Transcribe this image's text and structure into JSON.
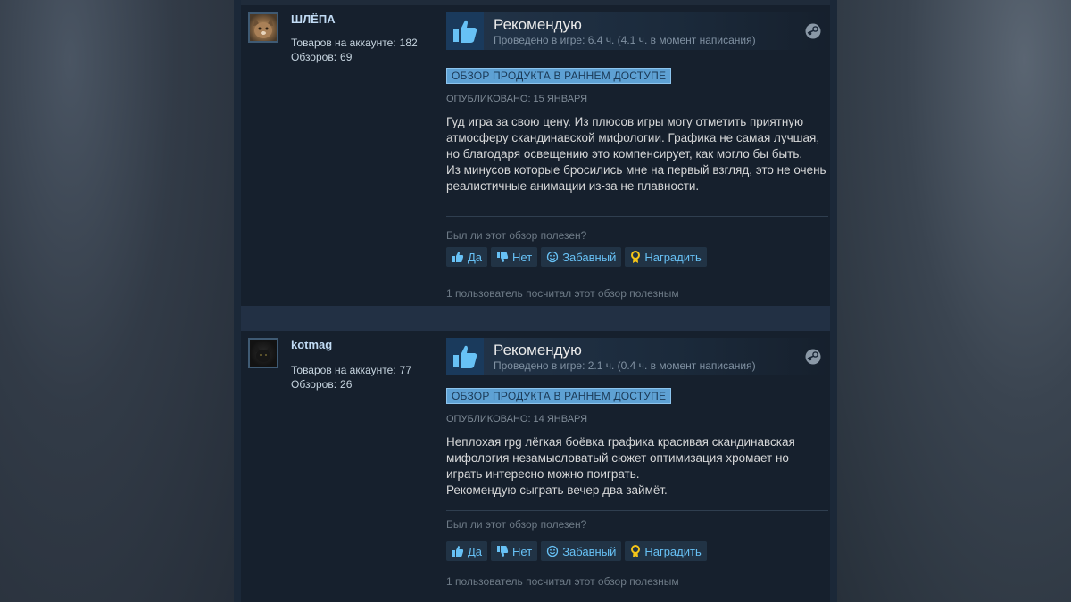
{
  "reviews": [
    {
      "username": "ШЛЁПА",
      "products_label": "Товаров на аккаунте:",
      "products_count": "182",
      "reviews_label": "Обзоров:",
      "reviews_count": "69",
      "verdict": "Рекомендую",
      "playtime": "Проведено в игре: 6.4 ч. (4.1 ч. в момент написания)",
      "early_access": "ОБЗОР ПРОДУКТА В РАННЕМ ДОСТУПЕ",
      "posted": "ОПУБЛИКОВАНО: 15 ЯНВАРЯ",
      "text": "Гуд игра за свою цену. Из плюсов игры могу отметить приятную атмосферу скандинавской мифологии. Графика не самая лучшая, но благодаря освещению это компенсирует, как могло бы быть.\nИз минусов которые бросились мне на первый взгляд, это не очень реалистичные анимации из-за не плавности.",
      "helpful_question": "Был ли этот обзор полезен?",
      "btn_yes": "Да",
      "btn_no": "Нет",
      "btn_funny": "Забавный",
      "btn_award": "Наградить",
      "found_helpful": "1 пользователь посчитал этот обзор полезным"
    },
    {
      "username": "kotmag",
      "products_label": "Товаров на аккаунте:",
      "products_count": "77",
      "reviews_label": "Обзоров:",
      "reviews_count": "26",
      "verdict": "Рекомендую",
      "playtime": "Проведено в игре: 2.1 ч. (0.4 ч. в момент написания)",
      "early_access": "ОБЗОР ПРОДУКТА В РАННЕМ ДОСТУПЕ",
      "posted": "ОПУБЛИКОВАНО: 14 ЯНВАРЯ",
      "text": "Неплохая rpg лёгкая боёвка графика красивая скандинавская мифология незамысловатый сюжет оптимизация хромает но играть интересно можно поиграть.\nРекомендую сыграть вечер два займёт.",
      "helpful_question": "Был ли этот обзор полезен?",
      "btn_yes": "Да",
      "btn_no": "Нет",
      "btn_funny": "Забавный",
      "btn_award": "Наградить",
      "found_helpful": "1 пользователь посчитал этот обзор полезным"
    }
  ],
  "colors": {
    "accent_blue": "#67c1f5",
    "badge_bg": "#5ea1d4",
    "award_gold": "#f5c518"
  },
  "icons": [
    "thumbs-up-icon",
    "thumbs-down-icon",
    "smiley-icon",
    "award-icon",
    "steam-icon"
  ]
}
